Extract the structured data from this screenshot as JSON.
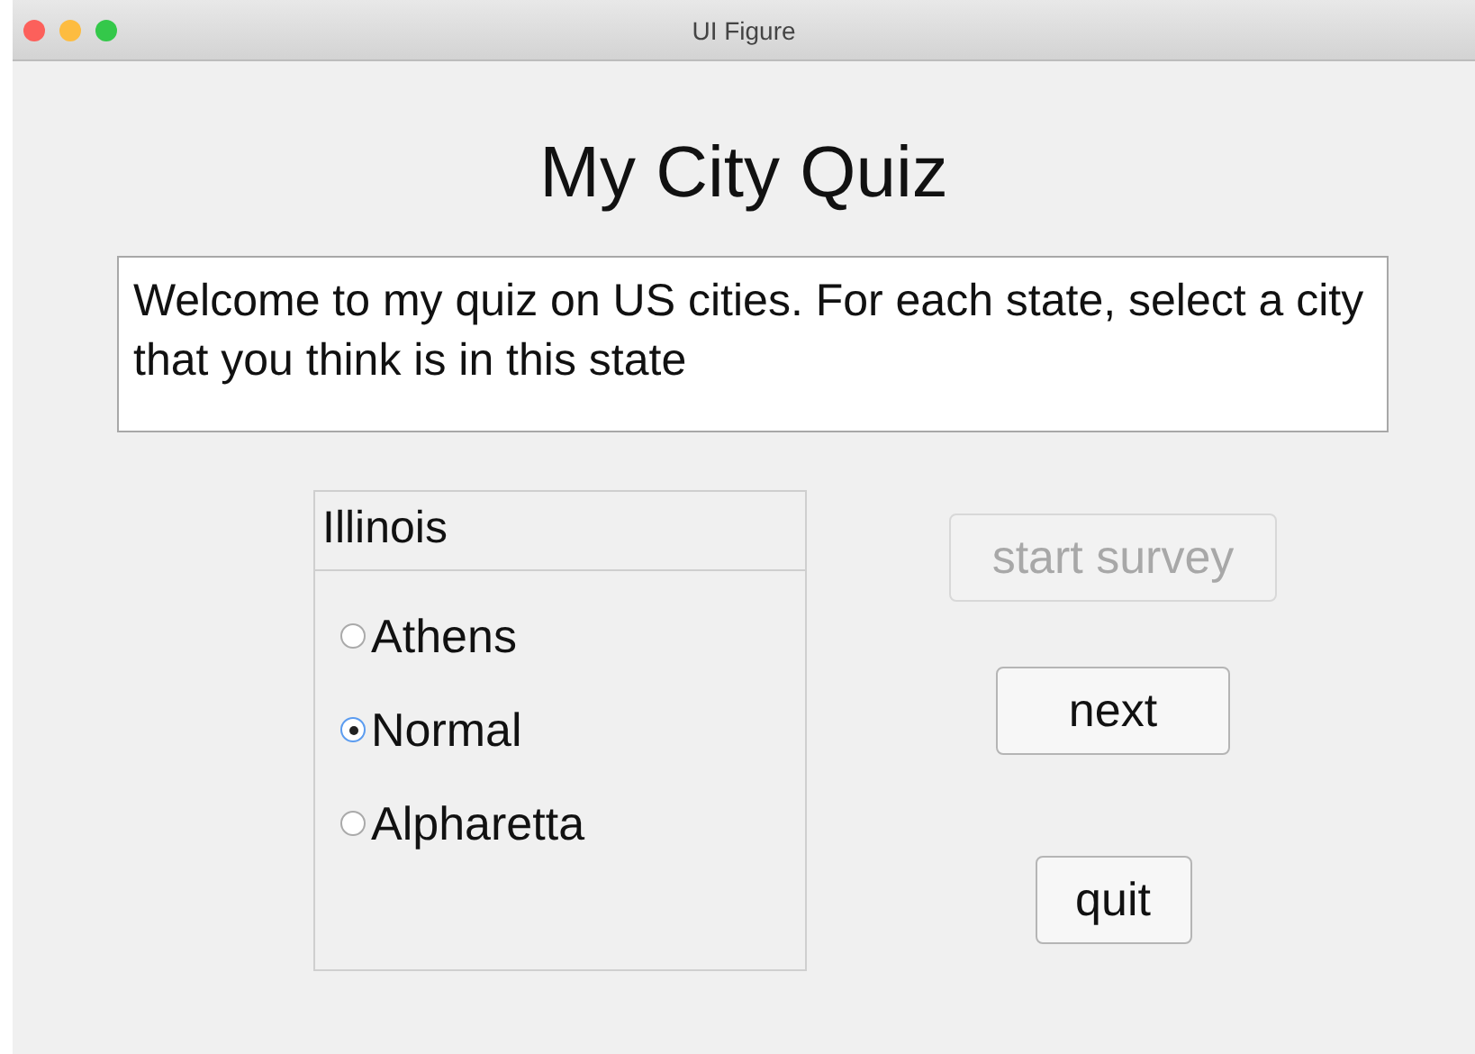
{
  "window": {
    "title": "UI Figure"
  },
  "heading": "My City Quiz",
  "intro_text": "Welcome to my quiz on US cities. For each state, select a city that you think is in this state",
  "question": {
    "title": "Illinois",
    "options": [
      {
        "label": "Athens",
        "selected": false
      },
      {
        "label": "Normal",
        "selected": true
      },
      {
        "label": "Alpharetta",
        "selected": false
      }
    ]
  },
  "buttons": [
    {
      "label": "start survey",
      "disabled": true
    },
    {
      "label": "next",
      "disabled": false
    },
    {
      "label": "quit",
      "disabled": false
    }
  ]
}
